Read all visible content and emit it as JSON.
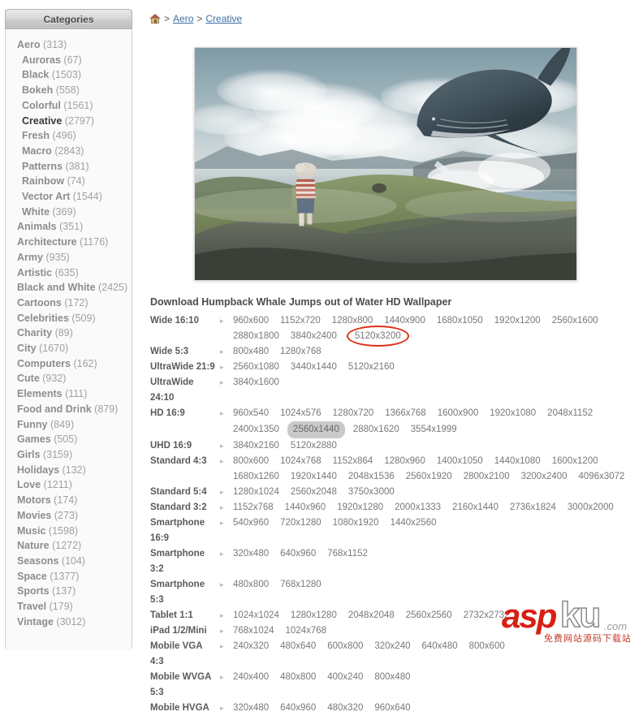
{
  "sidebar": {
    "header": "Categories",
    "items": [
      {
        "name": "Aero",
        "count": "(313)",
        "level": 0,
        "current": false
      },
      {
        "name": "Auroras",
        "count": "(67)",
        "level": 1,
        "current": false
      },
      {
        "name": "Black",
        "count": "(1503)",
        "level": 1,
        "current": false
      },
      {
        "name": "Bokeh",
        "count": "(558)",
        "level": 1,
        "current": false
      },
      {
        "name": "Colorful",
        "count": "(1561)",
        "level": 1,
        "current": false
      },
      {
        "name": "Creative",
        "count": "(2797)",
        "level": 1,
        "current": true
      },
      {
        "name": "Fresh",
        "count": "(496)",
        "level": 1,
        "current": false
      },
      {
        "name": "Macro",
        "count": "(2843)",
        "level": 1,
        "current": false
      },
      {
        "name": "Patterns",
        "count": "(381)",
        "level": 1,
        "current": false
      },
      {
        "name": "Rainbow",
        "count": "(74)",
        "level": 1,
        "current": false
      },
      {
        "name": "Vector Art",
        "count": "(1544)",
        "level": 1,
        "current": false
      },
      {
        "name": "White",
        "count": "(369)",
        "level": 1,
        "current": false
      },
      {
        "name": "Animals",
        "count": "(351)",
        "level": 0,
        "current": false
      },
      {
        "name": "Architecture",
        "count": "(1176)",
        "level": 0,
        "current": false
      },
      {
        "name": "Army",
        "count": "(935)",
        "level": 0,
        "current": false
      },
      {
        "name": "Artistic",
        "count": "(635)",
        "level": 0,
        "current": false
      },
      {
        "name": "Black and White",
        "count": "(2425)",
        "level": 0,
        "current": false
      },
      {
        "name": "Cartoons",
        "count": "(172)",
        "level": 0,
        "current": false
      },
      {
        "name": "Celebrities",
        "count": "(509)",
        "level": 0,
        "current": false
      },
      {
        "name": "Charity",
        "count": "(89)",
        "level": 0,
        "current": false
      },
      {
        "name": "City",
        "count": "(1670)",
        "level": 0,
        "current": false
      },
      {
        "name": "Computers",
        "count": "(162)",
        "level": 0,
        "current": false
      },
      {
        "name": "Cute",
        "count": "(932)",
        "level": 0,
        "current": false
      },
      {
        "name": "Elements",
        "count": "(111)",
        "level": 0,
        "current": false
      },
      {
        "name": "Food and Drink",
        "count": "(879)",
        "level": 0,
        "current": false
      },
      {
        "name": "Funny",
        "count": "(849)",
        "level": 0,
        "current": false
      },
      {
        "name": "Games",
        "count": "(505)",
        "level": 0,
        "current": false
      },
      {
        "name": "Girls",
        "count": "(3159)",
        "level": 0,
        "current": false
      },
      {
        "name": "Holidays",
        "count": "(132)",
        "level": 0,
        "current": false
      },
      {
        "name": "Love",
        "count": "(1211)",
        "level": 0,
        "current": false
      },
      {
        "name": "Motors",
        "count": "(174)",
        "level": 0,
        "current": false
      },
      {
        "name": "Movies",
        "count": "(273)",
        "level": 0,
        "current": false
      },
      {
        "name": "Music",
        "count": "(1598)",
        "level": 0,
        "current": false
      },
      {
        "name": "Nature",
        "count": "(1272)",
        "level": 0,
        "current": false
      },
      {
        "name": "Seasons",
        "count": "(104)",
        "level": 0,
        "current": false
      },
      {
        "name": "Space",
        "count": "(1377)",
        "level": 0,
        "current": false
      },
      {
        "name": "Sports",
        "count": "(137)",
        "level": 0,
        "current": false
      },
      {
        "name": "Travel",
        "count": "(179)",
        "level": 0,
        "current": false
      },
      {
        "name": "Vintage",
        "count": "(3012)",
        "level": 0,
        "current": false
      }
    ]
  },
  "breadcrumb": {
    "home_icon": "home-icon",
    "separator": ">",
    "links": [
      "Aero",
      "Creative"
    ]
  },
  "preview": {
    "alt": "Humpback Whale Jumps out of Water HD Wallpaper"
  },
  "download_title": "Download Humpback Whale Jumps out of Water HD Wallpaper",
  "resolutions": [
    {
      "label": "Wide 16:10",
      "values": [
        {
          "t": "960x600"
        },
        {
          "t": "1152x720"
        },
        {
          "t": "1280x800"
        },
        {
          "t": "1440x900"
        },
        {
          "t": "1680x1050"
        },
        {
          "t": "1920x1200"
        },
        {
          "t": "2560x1600"
        },
        {
          "t": "2880x1800"
        },
        {
          "t": "3840x2400"
        },
        {
          "t": "5120x3200",
          "style": "circled"
        }
      ]
    },
    {
      "label": "Wide 5:3",
      "values": [
        {
          "t": "800x480"
        },
        {
          "t": "1280x768"
        }
      ]
    },
    {
      "label": "UltraWide 21:9",
      "values": [
        {
          "t": "2560x1080"
        },
        {
          "t": "3440x1440"
        },
        {
          "t": "5120x2160"
        }
      ]
    },
    {
      "label": "UltraWide 24:10",
      "values": [
        {
          "t": "3840x1600"
        }
      ]
    },
    {
      "label": "HD 16:9",
      "values": [
        {
          "t": "960x540"
        },
        {
          "t": "1024x576"
        },
        {
          "t": "1280x720"
        },
        {
          "t": "1366x768"
        },
        {
          "t": "1600x900"
        },
        {
          "t": "1920x1080"
        },
        {
          "t": "2048x1152"
        },
        {
          "t": "2400x1350"
        },
        {
          "t": "2560x1440",
          "style": "hl"
        },
        {
          "t": "2880x1620"
        },
        {
          "t": "3554x1999"
        }
      ]
    },
    {
      "label": "UHD 16:9",
      "values": [
        {
          "t": "3840x2160"
        },
        {
          "t": "5120x2880"
        }
      ]
    },
    {
      "label": "Standard 4:3",
      "values": [
        {
          "t": "800x600"
        },
        {
          "t": "1024x768"
        },
        {
          "t": "1152x864"
        },
        {
          "t": "1280x960"
        },
        {
          "t": "1400x1050"
        },
        {
          "t": "1440x1080"
        },
        {
          "t": "1600x1200"
        },
        {
          "t": "1680x1260"
        },
        {
          "t": "1920x1440"
        },
        {
          "t": "2048x1536"
        },
        {
          "t": "2560x1920"
        },
        {
          "t": "2800x2100"
        },
        {
          "t": "3200x2400"
        },
        {
          "t": "4096x3072"
        }
      ]
    },
    {
      "label": "Standard 5:4",
      "values": [
        {
          "t": "1280x1024"
        },
        {
          "t": "2560x2048"
        },
        {
          "t": "3750x3000"
        }
      ]
    },
    {
      "label": "Standard 3:2",
      "values": [
        {
          "t": "1152x768"
        },
        {
          "t": "1440x960"
        },
        {
          "t": "1920x1280"
        },
        {
          "t": "2000x1333"
        },
        {
          "t": "2160x1440"
        },
        {
          "t": "2736x1824"
        },
        {
          "t": "3000x2000"
        }
      ]
    },
    {
      "label": "Smartphone 16:9",
      "values": [
        {
          "t": "540x960"
        },
        {
          "t": "720x1280"
        },
        {
          "t": "1080x1920"
        },
        {
          "t": "1440x2560"
        }
      ]
    },
    {
      "label": "Smartphone 3:2",
      "values": [
        {
          "t": "320x480"
        },
        {
          "t": "640x960"
        },
        {
          "t": "768x1152"
        }
      ]
    },
    {
      "label": "Smartphone 5:3",
      "values": [
        {
          "t": "480x800"
        },
        {
          "t": "768x1280"
        }
      ]
    },
    {
      "label": "Tablet 1:1",
      "values": [
        {
          "t": "1024x1024"
        },
        {
          "t": "1280x1280"
        },
        {
          "t": "2048x2048"
        },
        {
          "t": "2560x2560"
        },
        {
          "t": "2732x2732"
        }
      ]
    },
    {
      "label": "iPad 1/2/Mini",
      "values": [
        {
          "t": "768x1024"
        },
        {
          "t": "1024x768"
        }
      ]
    },
    {
      "label": "Mobile VGA 4:3",
      "values": [
        {
          "t": "240x320"
        },
        {
          "t": "480x640"
        },
        {
          "t": "600x800"
        },
        {
          "t": "320x240"
        },
        {
          "t": "640x480"
        },
        {
          "t": "800x600"
        }
      ]
    },
    {
      "label": "Mobile WVGA 5:3",
      "values": [
        {
          "t": "240x400"
        },
        {
          "t": "480x800"
        },
        {
          "t": "400x240"
        },
        {
          "t": "800x480"
        }
      ]
    },
    {
      "label": "Mobile HVGA",
      "values": [
        {
          "t": "320x480"
        },
        {
          "t": "640x960"
        },
        {
          "t": "480x320"
        },
        {
          "t": "960x640"
        }
      ]
    }
  ],
  "watermark": {
    "part1": "asp",
    "part2": "ku",
    "part3": ".com",
    "tagline": "免费网站源码下载站!"
  },
  "colors": {
    "accent_red": "#d81f14",
    "highlight_circle": "#e03018",
    "link": "#3b6ea5"
  }
}
